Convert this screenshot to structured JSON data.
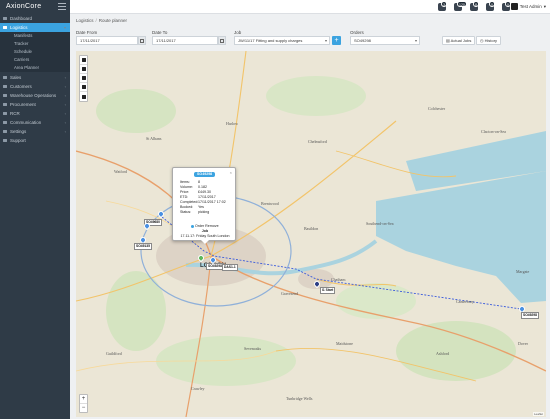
{
  "app": {
    "brand": "AxionCore"
  },
  "topbar": {
    "icons": [
      {
        "name": "tasks-icon",
        "badge": "3"
      },
      {
        "name": "inbox-icon",
        "badge": "120"
      },
      {
        "name": "alerts-icon",
        "badge": "8"
      },
      {
        "name": "messages-icon",
        "badge": "0"
      },
      {
        "name": "settings-icon",
        "badge": "0"
      }
    ],
    "user": "Test Admin"
  },
  "sidebar": {
    "items": [
      {
        "label": "Dashboard",
        "icon": "dashboard-icon"
      },
      {
        "label": "Logistics",
        "icon": "truck-icon",
        "active": true
      },
      {
        "label": "Sales",
        "icon": "cart-icon"
      },
      {
        "label": "Customers",
        "icon": "users-icon"
      },
      {
        "label": "Warehouse Operations",
        "icon": "warehouse-icon"
      },
      {
        "label": "Procurement",
        "icon": "box-icon"
      },
      {
        "label": "RCR",
        "icon": "refresh-icon"
      },
      {
        "label": "Communication",
        "icon": "chat-icon"
      },
      {
        "label": "Settings",
        "icon": "gear-icon"
      },
      {
        "label": "Support",
        "icon": "help-icon"
      }
    ],
    "subitems": [
      "Manifests",
      "Tracker",
      "Schedule",
      "Carriers",
      "Area Planner"
    ]
  },
  "breadcrumb": {
    "parent": "Logistics",
    "current": "Route planner"
  },
  "filters": {
    "date_from_label": "Date From",
    "date_from_value": "17/11/2017",
    "date_to_label": "Date To",
    "date_to_value": "17/11/2017",
    "job_label": "Job",
    "job_value": "JW/11/17 Fitting and supply charges",
    "orders_label": "Orders",
    "orders_value": "SO49298",
    "actual_jobs_label": "Actual Jobs",
    "history_label": "History"
  },
  "map": {
    "places": [
      "LONDON",
      "Watford",
      "St Albans",
      "Harlow",
      "Chelmsford",
      "Brentwood",
      "Basildon",
      "Southend-on-Sea",
      "Gravesend",
      "Chatham",
      "Maidstone",
      "Canterbury",
      "Sevenoaks",
      "Tunbridge Wells",
      "Colchester",
      "Clacton-on-Sea",
      "Margate",
      "Ashford",
      "Crawley",
      "Guildford",
      "Dover"
    ],
    "attribution": "Leaflet",
    "zoom_in": "+",
    "zoom_out": "−",
    "markers": [
      {
        "label": "SO49680"
      },
      {
        "label": "SO49135"
      },
      {
        "label": "SO49298"
      },
      {
        "label": "DAS1-1"
      },
      {
        "label": "I1 Start"
      },
      {
        "label": "SO49298"
      }
    ]
  },
  "popup": {
    "title": "SO49298",
    "rows": [
      {
        "k": "Items:",
        "v": "8"
      },
      {
        "k": "Volume:",
        "v": "0.182"
      },
      {
        "k": "Price:",
        "v": "£449.30"
      },
      {
        "k": "ETD:",
        "v": "17/11/2017"
      },
      {
        "k": "Completed:",
        "v": "17/11/2017 17:02"
      },
      {
        "k": "Booked:",
        "v": "Yes"
      },
      {
        "k": "Status:",
        "v": "picking"
      }
    ],
    "radio_label": "Order Remove",
    "job_heading": "Job",
    "job_text": "17.11.17: Friday South London"
  }
}
